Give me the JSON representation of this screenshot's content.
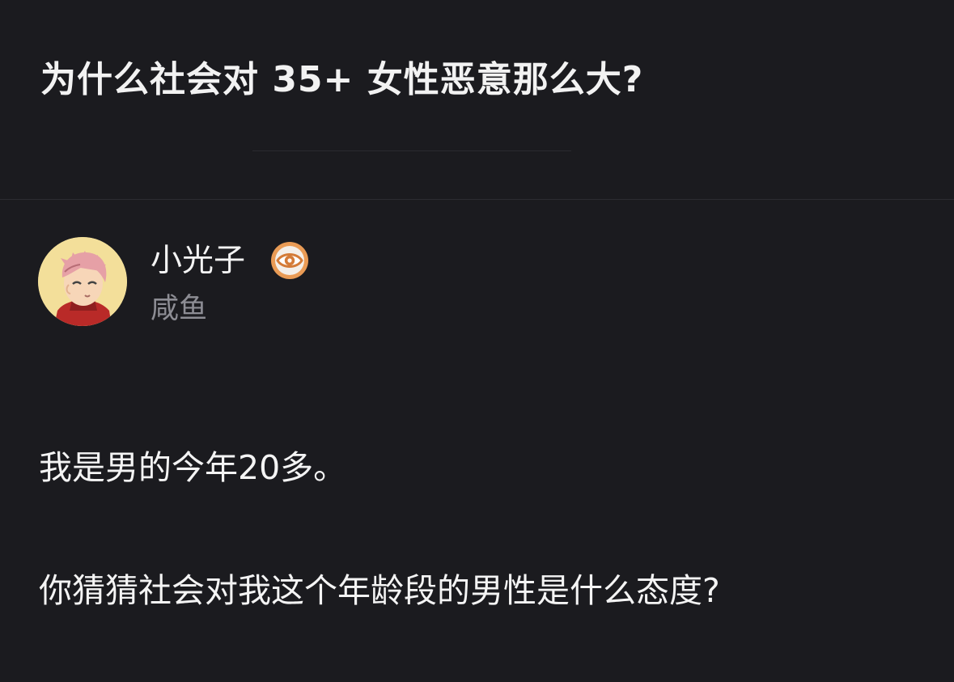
{
  "question": {
    "title": "为什么社会对 35+ 女性恶意那么大?"
  },
  "author": {
    "name": "小光子",
    "tag": "咸鱼",
    "avatar_icon": "anime-boy-avatar",
    "badge_icon": "eye-badge-icon"
  },
  "answer": {
    "paragraphs": [
      "我是男的今年20多。",
      "你猜猜社会对我这个年龄段的男性是什么态度?"
    ]
  },
  "colors": {
    "background": "#1b1b1f",
    "title_text": "#f2f2f2",
    "secondary_text": "#8d8d94",
    "badge_orange": "#e99b55"
  }
}
